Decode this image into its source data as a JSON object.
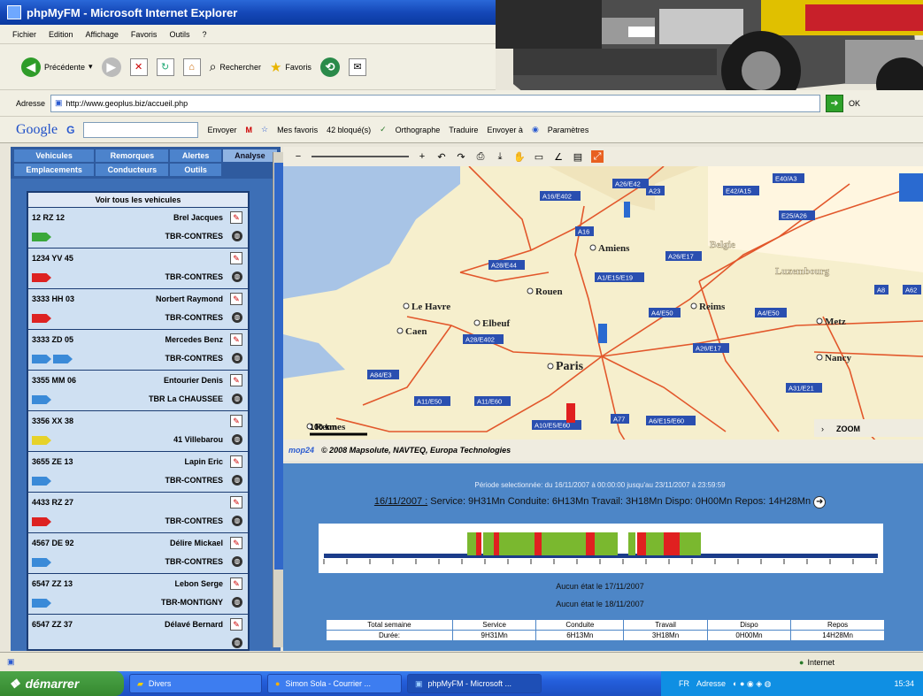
{
  "window": {
    "title": "phpMyFM - Microsoft Internet Explorer"
  },
  "menu": [
    "Fichier",
    "Edition",
    "Affichage",
    "Favoris",
    "Outils",
    "?"
  ],
  "toolbar": {
    "back_label": "Précédente",
    "search_label": "Rechercher",
    "favorites_label": "Favoris"
  },
  "address": {
    "label": "Adresse",
    "url": "http://www.geoplus.biz/accueil.php",
    "go_label": "OK"
  },
  "google": {
    "logo": "Google",
    "g_label": "G",
    "send_label": "Envoyer",
    "favorites_label": "Mes favoris",
    "blocked_label": "42 bloqué(s)",
    "spell_label": "Orthographe",
    "translate_label": "Traduire",
    "sendto_label": "Envoyer à",
    "settings_label": "Paramètres"
  },
  "nav_tabs": [
    "Vehicules",
    "Remorques",
    "Alertes",
    "Analyse",
    "Emplacements",
    "Conducteurs",
    "Outils"
  ],
  "vehicles_header": "Voir tous les vehicules",
  "vehicles": [
    {
      "plate": "12 RZ 12",
      "driver": "Brel Jacques",
      "company": "TBR-CONTRES",
      "flag": "green"
    },
    {
      "plate": "1234 YV 45",
      "driver": "",
      "company": "TBR-CONTRES",
      "flag": "red"
    },
    {
      "plate": "3333 HH 03",
      "driver": "Norbert Raymond",
      "company": "TBR-CONTRES",
      "flag": "red"
    },
    {
      "plate": "3333 ZD 05",
      "driver": "Mercedes Benz",
      "company": "TBR-CONTRES",
      "flag": "blue2"
    },
    {
      "plate": "3355 MM 06",
      "driver": "Entourier Denis",
      "company": "TBR La CHAUSSEE",
      "flag": "blue"
    },
    {
      "plate": "3356 XX 38",
      "driver": "",
      "company": "41 Villebarou",
      "flag": "yellow"
    },
    {
      "plate": "3655 ZE 13",
      "driver": "Lapin Eric",
      "company": "TBR-CONTRES",
      "flag": "blue"
    },
    {
      "plate": "4433 RZ 27",
      "driver": "",
      "company": "TBR-CONTRES",
      "flag": "red"
    },
    {
      "plate": "4567 DE 92",
      "driver": "Délire Mickael",
      "company": "TBR-CONTRES",
      "flag": "blue"
    },
    {
      "plate": "6547 ZZ 13",
      "driver": "Lebon Serge",
      "company": "TBR-MONTIGNY",
      "flag": "blue"
    },
    {
      "plate": "6547 ZZ 37",
      "driver": "Délavé Bernard",
      "company": "",
      "flag": ""
    }
  ],
  "map": {
    "cities": [
      "Amiens",
      "Rouen",
      "Le Havre",
      "Caen",
      "Elbeuf",
      "Reims",
      "Paris",
      "Metz",
      "Nancy",
      "Rennes",
      "Belgie",
      "Luxembourg"
    ],
    "road_labels": [
      "A26/E42",
      "A23",
      "E42/A15",
      "E40/A3",
      "A16/E402",
      "A16",
      "A26/E17",
      "E25/A26",
      "A28/E44",
      "A1/E15/E19",
      "A4/E50",
      "A4/E50",
      "A28/E402",
      "A26/E17",
      "A84/E3",
      "A11/E50",
      "A11/E60",
      "A10/E5/E60",
      "A77",
      "A6/E15/E60",
      "A31/E21",
      "A8",
      "A62"
    ],
    "scale": "100 km",
    "zoom_label": "ZOOM",
    "footer_logo": "mop24",
    "copyright": "© 2008 Mapsolute, NAVTEQ, Europa Technologies"
  },
  "report": {
    "period": "Période selectionnée: du 16/11/2007 à 00:00:00 jusqu'au 23/11/2007 à 23:59:59",
    "day": "16/11/2007 :",
    "summary": "Service: 9H31Mn Conduite: 6H13Mn Travail: 3H18Mn Dispo: 0H00Mn Repos: 14H28Mn",
    "no_state_1": "Aucun état le 17/11/2007",
    "no_state_2": "Aucun état le 18/11/2007",
    "table_headers": [
      "Total semaine",
      "Service",
      "Conduite",
      "Travail",
      "Dispo",
      "Repos"
    ],
    "table_row": [
      "Durée:",
      "9H31Mn",
      "6H13Mn",
      "3H18Mn",
      "0H00Mn",
      "14H28Mn"
    ]
  },
  "status": {
    "zone": "Internet"
  },
  "taskbar": {
    "start": "démarrer",
    "tasks": [
      "Divers",
      "Simon Sola - Courrier ...",
      "phpMyFM - Microsoft ..."
    ],
    "lang": "FR",
    "address_label": "Adresse",
    "time": "15:34"
  },
  "colors": {
    "panel_blue": "#3d6fb6",
    "title_blue": "#1548b8",
    "map_bg": "#f6efcd",
    "road": "#e2572b",
    "driving": "#7ab82f",
    "work": "#e02020"
  }
}
